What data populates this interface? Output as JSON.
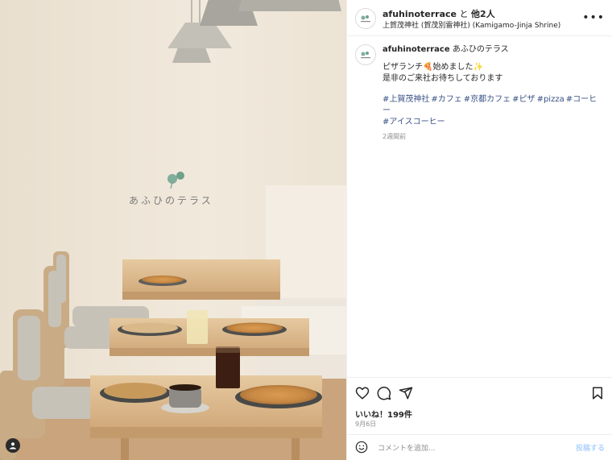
{
  "post": {
    "header": {
      "username": "afuhinoterrace",
      "joiner": "と",
      "others": "他2人",
      "location": "上賀茂神社 (賀茂別雷神社) (Kamigamo-Jinja Shrine)"
    },
    "photo": {
      "logo_text": "あふひのテラス"
    },
    "caption": {
      "username": "afuhinoterrace",
      "shop_name": "あふひのテラス",
      "line1": "ピザランチ🍕始めました✨",
      "line2": "是非のご来社お待ちしております",
      "hashtags": [
        "#上賀茂神社",
        "#カフェ",
        "#京都カフェ",
        "#ピザ",
        "#pizza",
        "#コーヒー",
        "#アイスコーヒー"
      ],
      "time_ago": "2週間前"
    },
    "stats": {
      "likes": "いいね！199件",
      "date": "9月6日"
    },
    "comment": {
      "placeholder": "コメントを追加...",
      "post_label": "投稿する"
    },
    "colors": {
      "link": "#00376b",
      "muted": "#8e8e8e",
      "post_disabled": "#b3d4fc"
    }
  }
}
